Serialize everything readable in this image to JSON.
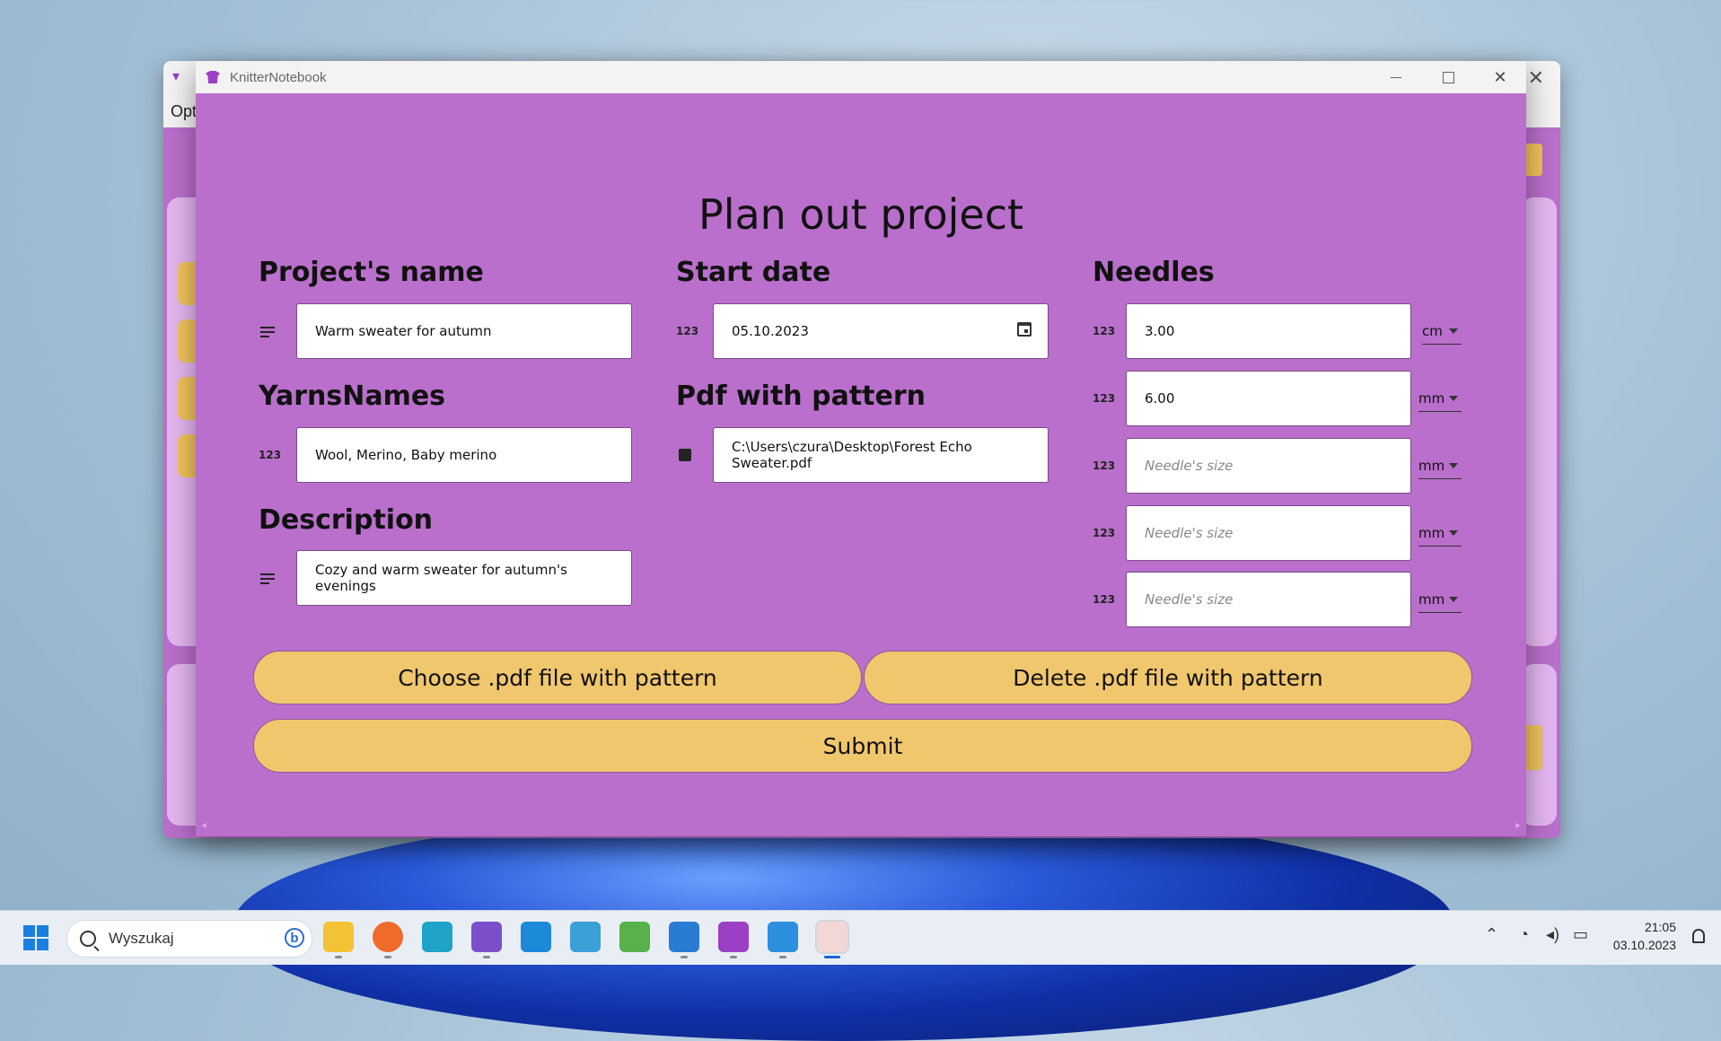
{
  "window": {
    "app_title": "KnitterNotebook",
    "background_menu_label": "Opt"
  },
  "form": {
    "title": "Plan out project",
    "project_name": {
      "label": "Project's name",
      "value": "Warm sweater for autumn"
    },
    "yarns_names": {
      "label": "YarnsNames",
      "value": "Wool, Merino, Baby merino"
    },
    "description": {
      "label": "Description",
      "value": "Cozy and warm sweater for autumn's evenings"
    },
    "start_date": {
      "label": "Start date",
      "value": "05.10.2023"
    },
    "pdf_pattern": {
      "label": "Pdf with pattern",
      "value": "C:\\Users\\czura\\Desktop\\Forest Echo Sweater.pdf"
    },
    "needles": {
      "label": "Needles",
      "items": [
        {
          "value": "3.00",
          "placeholder": "Needle's size",
          "unit": "cm"
        },
        {
          "value": "6.00",
          "placeholder": "Needle's size",
          "unit": "mm"
        },
        {
          "value": "",
          "placeholder": "Needle's size",
          "unit": "mm"
        },
        {
          "value": "",
          "placeholder": "Needle's size",
          "unit": "mm"
        },
        {
          "value": "",
          "placeholder": "Needle's size",
          "unit": "mm"
        }
      ]
    },
    "icons": {
      "text_field": "lines-icon",
      "numeric_field": "123",
      "image_field": "image-icon",
      "date_picker": "calendar-icon"
    },
    "buttons": {
      "choose_pdf": "Choose .pdf file with pattern",
      "delete_pdf": "Delete .pdf file with pattern",
      "submit": "Submit"
    }
  },
  "taskbar": {
    "search_placeholder": "Wyszukaj",
    "time": "21:05",
    "date": "03.10.2023"
  },
  "colors": {
    "window_bg": "#b96fcb",
    "button_bg": "#f1c76e",
    "titlebar_bg": "#f3f3f3"
  }
}
